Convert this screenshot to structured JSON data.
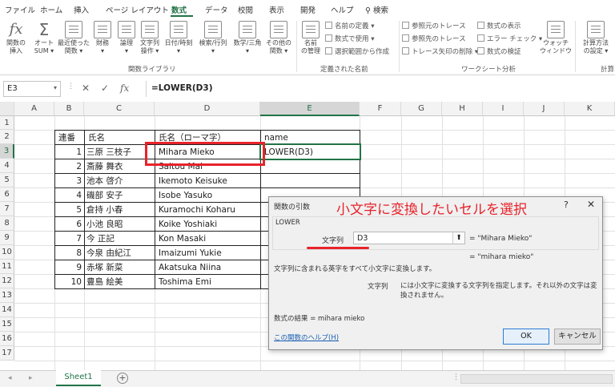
{
  "ribbon_tabs": [
    "ファイル",
    "ホーム",
    "挿入",
    "ページ レイアウト",
    "数式",
    "データ",
    "校閲",
    "表示",
    "開発",
    "ヘルプ",
    "検索"
  ],
  "ribbon": {
    "buttons": [
      {
        "name": "insert-function",
        "label": "関数の\n挿入",
        "icon": "fx"
      },
      {
        "name": "autosum",
        "label": "オート\nSUM ▾",
        "icon": "sigma"
      },
      {
        "name": "recently-used",
        "label": "最近使った\n関数 ▾",
        "icon": "star"
      },
      {
        "name": "financial",
        "label": "財務\n▾",
        "icon": "book"
      },
      {
        "name": "logical",
        "label": "論理\n▾",
        "icon": "book"
      },
      {
        "name": "text",
        "label": "文字列\n操作 ▾",
        "icon": "book"
      },
      {
        "name": "datetime",
        "label": "日付/時刻\n▾",
        "icon": "book"
      },
      {
        "name": "lookup",
        "label": "検索/行列\n▾",
        "icon": "book"
      },
      {
        "name": "math",
        "label": "数学/三角\n▾",
        "icon": "book"
      },
      {
        "name": "more",
        "label": "その他の\n関数 ▾",
        "icon": "book"
      },
      {
        "name": "name-manager",
        "label": "名前\nの管理",
        "icon": "tag"
      },
      {
        "name": "watch-window",
        "label": "ウォッチ\nウィンドウ",
        "icon": "window"
      },
      {
        "name": "calc-options",
        "label": "計算方法\nの設定 ▾",
        "icon": "calc"
      }
    ],
    "small": {
      "define_name": "名前の定義 ▾",
      "use_in_formula": "数式で使用 ▾",
      "create_from_selection": "選択範囲から作成",
      "trace_precedents": "参照元のトレース",
      "trace_dependents": "参照先のトレース",
      "remove_arrows": "トレース矢印の削除 ▾",
      "show_formulas": "数式の表示",
      "error_checking": "エラー チェック ▾",
      "evaluate_formula": "数式の検証"
    },
    "groups": [
      "関数ライブラリ",
      "定義された名前",
      "ワークシート分析",
      "計算"
    ]
  },
  "formula_bar": {
    "name_box": "E3",
    "formula": "=LOWER(D3)"
  },
  "grid": {
    "columns": [
      "A",
      "B",
      "C",
      "D",
      "E",
      "F",
      "G",
      "H",
      "I",
      "J",
      "K"
    ],
    "rows": [
      "1",
      "2",
      "3",
      "4",
      "5",
      "6",
      "7",
      "8",
      "9",
      "10",
      "11",
      "12",
      "13",
      "14",
      "15",
      "16",
      "17"
    ],
    "headers": {
      "no": "連番",
      "name": "氏名",
      "romaji": "氏名（ローマ字）",
      "lower": "name"
    },
    "records": [
      {
        "no": "1",
        "name": "三原 三枝子",
        "romaji": "Mihara Mieko",
        "lower": "LOWER(D3)"
      },
      {
        "no": "2",
        "name": "斎藤 舞衣",
        "romaji": "Saitou Mai",
        "lower": ""
      },
      {
        "no": "3",
        "name": "池本 啓介",
        "romaji": "Ikemoto Keisuke",
        "lower": ""
      },
      {
        "no": "4",
        "name": "磯部 安子",
        "romaji": "Isobe Yasuko",
        "lower": ""
      },
      {
        "no": "5",
        "name": "倉持 小春",
        "romaji": "Kuramochi Koharu",
        "lower": ""
      },
      {
        "no": "6",
        "name": "小池 良昭",
        "romaji": "Koike Yoshiaki",
        "lower": ""
      },
      {
        "no": "7",
        "name": "今 正記",
        "romaji": "Kon Masaki",
        "lower": ""
      },
      {
        "no": "8",
        "name": "今泉 由紀江",
        "romaji": "Imaizumi Yukie",
        "lower": ""
      },
      {
        "no": "9",
        "name": "赤塚 新菜",
        "romaji": "Akatsuka Niina",
        "lower": ""
      },
      {
        "no": "10",
        "name": "豊島 絵美",
        "romaji": "Toshima Emi",
        "lower": ""
      }
    ]
  },
  "dialog": {
    "title": "関数の引数",
    "annotation": "小文字に変換したいセルを選択",
    "function_name": "LOWER",
    "arg_label": "文字列",
    "arg_value": "D3",
    "arg_result": "= \"Mihara Mieko\"",
    "result_preview": "= \"mihara mieko\"",
    "description": "文字列に含まれる英字をすべて小文字に変換します。",
    "arg_desc_name": "文字列",
    "arg_desc": "には小文字に変換する文字列を指定します。それ以外の文字は変換されません。",
    "formula_result": "数式の結果 =   mihara mieko",
    "help_link": "この関数のヘルプ(H)",
    "ok": "OK",
    "cancel": "キャンセル",
    "help": "?",
    "close": "✕"
  },
  "sheet_tabs": {
    "active": "Sheet1",
    "add": "+"
  },
  "colors": {
    "accent": "#217346",
    "annotation_red": "#e8232b",
    "link": "#1a5fb4"
  }
}
